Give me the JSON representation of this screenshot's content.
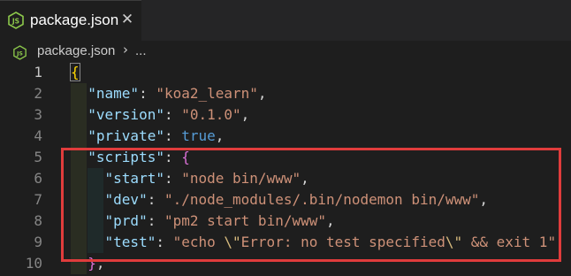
{
  "tab": {
    "title": "package.json",
    "close_glyph": "✕",
    "icon": "nodejs-file-icon"
  },
  "breadcrumb": {
    "file": "package.json",
    "separator": "›",
    "more": "..."
  },
  "highlight_color": "#e03c3c",
  "editor": {
    "line_numbers": [
      "1",
      "2",
      "3",
      "4",
      "5",
      "6",
      "7",
      "8",
      "9",
      "10"
    ],
    "lines": [
      [
        {
          "t": "p",
          "v": "{"
        }
      ],
      [
        {
          "t": "p",
          "v": "  "
        },
        {
          "t": "k",
          "v": "\"name\""
        },
        {
          "t": "p",
          "v": ": "
        },
        {
          "t": "s",
          "v": "\"koa2_learn\""
        },
        {
          "t": "p",
          "v": ","
        }
      ],
      [
        {
          "t": "p",
          "v": "  "
        },
        {
          "t": "k",
          "v": "\"version\""
        },
        {
          "t": "p",
          "v": ": "
        },
        {
          "t": "s",
          "v": "\"0.1.0\""
        },
        {
          "t": "p",
          "v": ","
        }
      ],
      [
        {
          "t": "p",
          "v": "  "
        },
        {
          "t": "k",
          "v": "\"private\""
        },
        {
          "t": "p",
          "v": ": "
        },
        {
          "t": "b",
          "v": "true"
        },
        {
          "t": "p",
          "v": ","
        }
      ],
      [
        {
          "t": "p",
          "v": "  "
        },
        {
          "t": "k",
          "v": "\"scripts\""
        },
        {
          "t": "p",
          "v": ": "
        },
        {
          "t": "m",
          "v": "{"
        }
      ],
      [
        {
          "t": "p",
          "v": "    "
        },
        {
          "t": "k",
          "v": "\"start\""
        },
        {
          "t": "p",
          "v": ": "
        },
        {
          "t": "s",
          "v": "\"node bin/www\""
        },
        {
          "t": "p",
          "v": ","
        }
      ],
      [
        {
          "t": "p",
          "v": "    "
        },
        {
          "t": "k",
          "v": "\"dev\""
        },
        {
          "t": "p",
          "v": ": "
        },
        {
          "t": "s",
          "v": "\"./node_modules/.bin/nodemon bin/www\""
        },
        {
          "t": "p",
          "v": ","
        }
      ],
      [
        {
          "t": "p",
          "v": "    "
        },
        {
          "t": "k",
          "v": "\"prd\""
        },
        {
          "t": "p",
          "v": ": "
        },
        {
          "t": "s",
          "v": "\"pm2 start bin/www\""
        },
        {
          "t": "p",
          "v": ","
        }
      ],
      [
        {
          "t": "p",
          "v": "    "
        },
        {
          "t": "k",
          "v": "\"test\""
        },
        {
          "t": "p",
          "v": ": "
        },
        {
          "t": "s",
          "v": "\"echo "
        },
        {
          "t": "esc",
          "v": "\\\""
        },
        {
          "t": "s",
          "v": "Error: no test specified"
        },
        {
          "t": "esc",
          "v": "\\\""
        },
        {
          "t": "s",
          "v": " && exit 1\""
        }
      ],
      [
        {
          "t": "p",
          "v": "  "
        },
        {
          "t": "m",
          "v": "}"
        },
        {
          "t": "p",
          "v": ","
        }
      ]
    ]
  }
}
